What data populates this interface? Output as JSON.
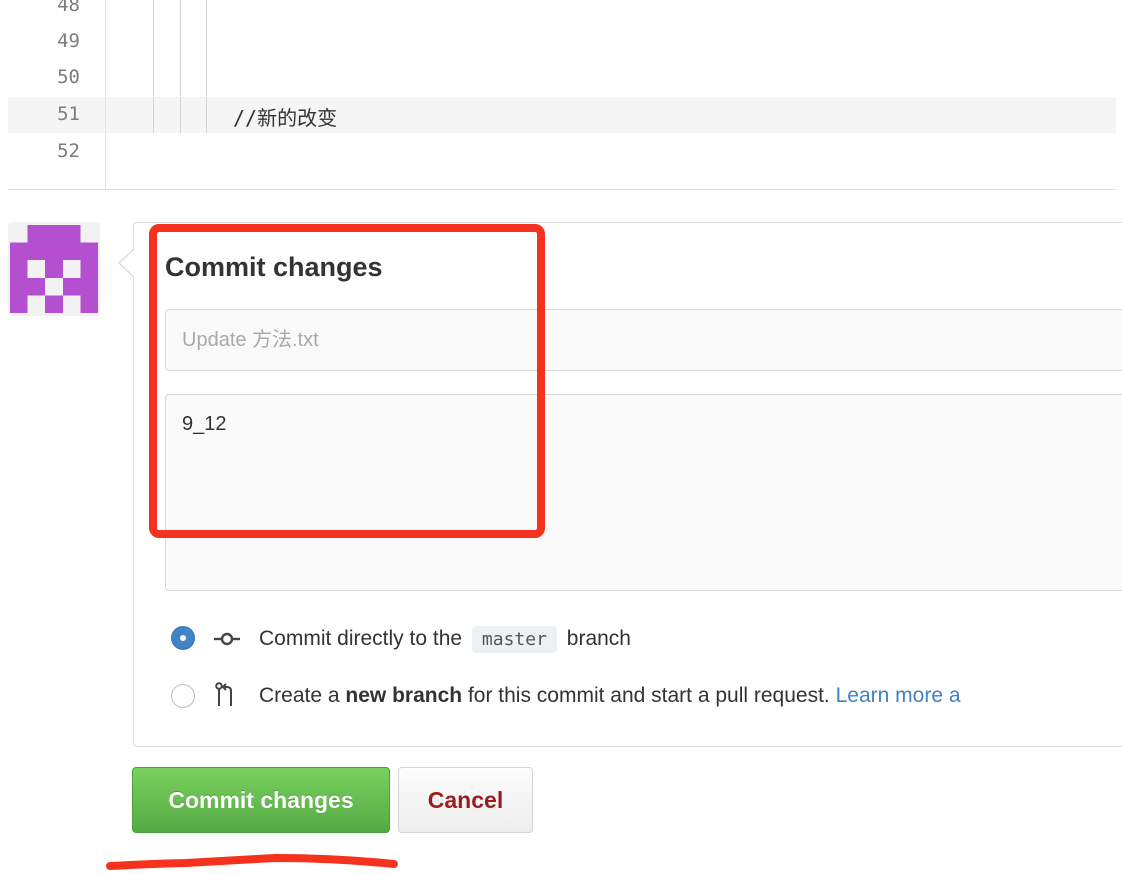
{
  "editor": {
    "lines": [
      {
        "number": "48",
        "code": ""
      },
      {
        "number": "49",
        "code": ""
      },
      {
        "number": "50",
        "code": ""
      },
      {
        "number": "51",
        "code": "//新的改变"
      },
      {
        "number": "52",
        "code": ""
      }
    ]
  },
  "commit_form": {
    "title": "Commit changes",
    "summary_placeholder": "Update 方法.txt",
    "description_value": "9_12",
    "option_direct": {
      "prefix": "Commit directly to the",
      "branch": "master",
      "suffix": "branch",
      "selected": true
    },
    "option_new_branch": {
      "prefix": "Create a",
      "bold": "new branch",
      "suffix": "for this commit and start a pull request.",
      "link": "Learn more a",
      "selected": false
    },
    "commit_button": "Commit changes",
    "cancel_button": "Cancel"
  },
  "colors": {
    "annotation_red": "#f5321e",
    "avatar_purple": "#b44fd0",
    "commit_green": "#5bb048",
    "link_blue": "#4183c4",
    "cancel_red": "#9b1c1c"
  },
  "icons": {
    "commit_option": "git-commit-icon",
    "branch_option": "git-pull-request-icon"
  }
}
